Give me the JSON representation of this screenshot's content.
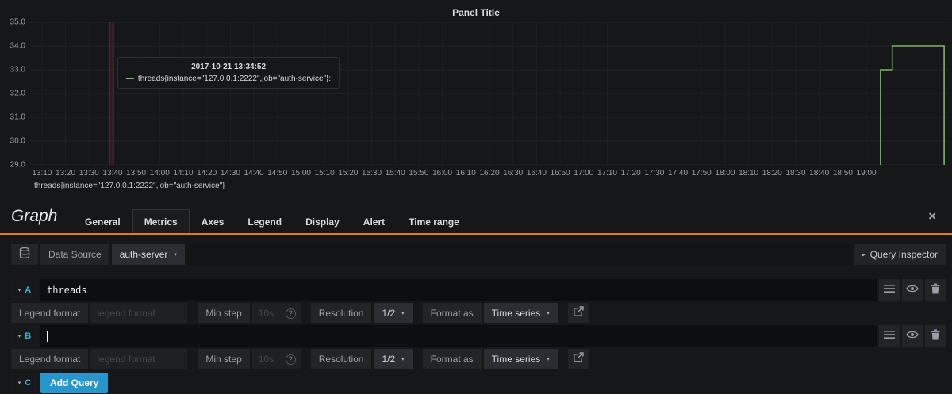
{
  "panel": {
    "title": "Panel Title",
    "legend_series": "threads{instance=\"127.0.0.1:2222\",job=\"auth-service\"}",
    "tooltip": {
      "time": "2017-10-21 13:34:52",
      "series_label": "threads{instance=\"127.0.0.1:2222\",job=\"auth-service\"}:"
    }
  },
  "chart_data": {
    "type": "line",
    "title": "Panel Title",
    "x_range": [
      "13:05",
      "19:35"
    ],
    "x_ticks": [
      "13:10",
      "13:20",
      "13:30",
      "13:40",
      "13:50",
      "14:00",
      "14:10",
      "14:20",
      "14:30",
      "14:40",
      "14:50",
      "15:00",
      "15:10",
      "15:20",
      "15:30",
      "15:40",
      "15:50",
      "16:00",
      "16:10",
      "16:20",
      "16:30",
      "16:40",
      "16:50",
      "17:00",
      "17:10",
      "17:20",
      "17:30",
      "17:40",
      "17:50",
      "18:00",
      "18:10",
      "18:20",
      "18:30",
      "18:40",
      "18:50",
      "19:00"
    ],
    "ylim": [
      29.0,
      35.0
    ],
    "y_ticks": [
      "35.0",
      "34.0",
      "33.0",
      "32.0",
      "31.0",
      "30.0",
      "29.0"
    ],
    "grid": true,
    "legend_position": "bottom-left",
    "cursor_time": "13:40",
    "series": [
      {
        "name": "threads{instance=\"127.0.0.1:2222\",job=\"auth-service\"}",
        "color": "#7eb26d",
        "points": [
          [
            "19:06",
            29
          ],
          [
            "19:06",
            33
          ],
          [
            "19:11",
            33
          ],
          [
            "19:11",
            34
          ],
          [
            "19:33",
            34
          ],
          [
            "19:33",
            29
          ]
        ]
      }
    ]
  },
  "editor": {
    "title": "Graph",
    "tabs": [
      {
        "label": "General",
        "active": false
      },
      {
        "label": "Metrics",
        "active": true
      },
      {
        "label": "Axes",
        "active": false
      },
      {
        "label": "Legend",
        "active": false
      },
      {
        "label": "Display",
        "active": false
      },
      {
        "label": "Alert",
        "active": false
      },
      {
        "label": "Time range",
        "active": false
      }
    ],
    "datasource": {
      "label": "Data Source",
      "value": "auth-server",
      "query_inspector_label": "Query Inspector"
    },
    "option_labels": {
      "legend_format": "Legend format",
      "legend_format_placeholder": "legend format",
      "min_step": "Min step",
      "min_step_placeholder": "10s",
      "resolution": "Resolution",
      "resolution_value": "1/2",
      "format_as": "Format as",
      "format_as_value": "Time series"
    },
    "queries": [
      {
        "ref": "A",
        "expr": "threads"
      },
      {
        "ref": "B",
        "expr": ""
      }
    ],
    "add_query": {
      "ref": "C",
      "label": "Add Query"
    }
  },
  "icons": {
    "caret_down": "▾",
    "caret_right": "▸",
    "series_dash": "—",
    "close": "×",
    "help": "?"
  },
  "colors": {
    "accent_orange": "#eb7b18",
    "series_green": "#7eb26d",
    "cursor_red": "#c4162a",
    "ref_blue": "#33b5e5",
    "add_query_blue": "#2796cc"
  }
}
